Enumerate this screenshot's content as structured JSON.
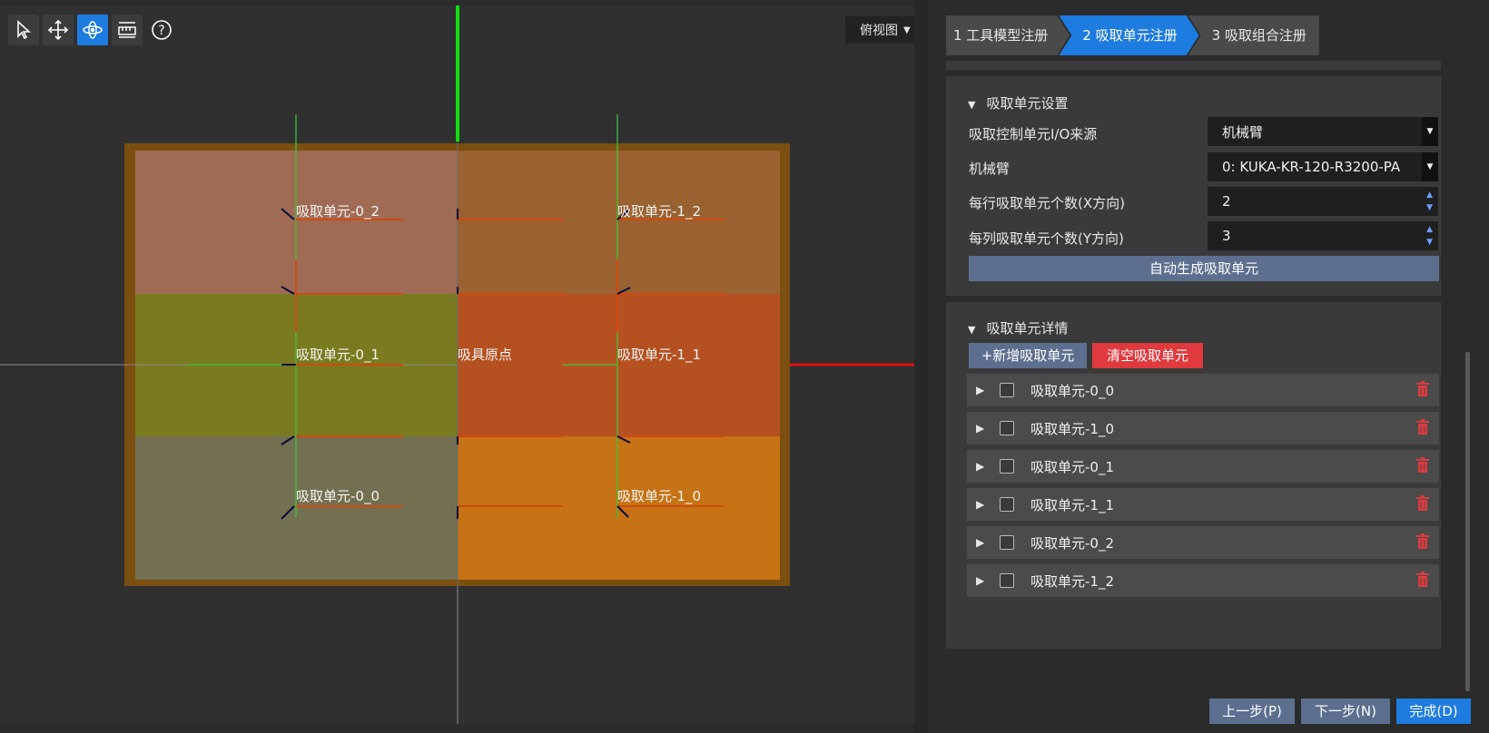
{
  "toolbar": {
    "tools": [
      {
        "name": "select-icon",
        "active": false
      },
      {
        "name": "move-icon",
        "active": false
      },
      {
        "name": "orbit-icon",
        "active": true
      },
      {
        "name": "ruler-icon",
        "active": false
      },
      {
        "name": "help-icon",
        "active": false
      }
    ]
  },
  "view": {
    "selected": "俯视图"
  },
  "scene": {
    "cells": [
      {
        "label": "吸取单元-0_2",
        "color": "#a06b55"
      },
      {
        "label": "",
        "color": "#9a6230"
      },
      {
        "label": "吸取单元-1_2",
        "color": "#9a6230"
      },
      {
        "label": "吸取单元-0_1",
        "color": "#7a7b20"
      },
      {
        "label": "吸具原点",
        "color": "#b55120"
      },
      {
        "label": "吸取单元-1_1",
        "color": "#b55120"
      },
      {
        "label": "吸取单元-0_0",
        "color": "#727050"
      },
      {
        "label": "",
        "color": "#c67315"
      },
      {
        "label": "吸取单元-1_0",
        "color": "#c67315"
      }
    ],
    "frame_color": "#7a4f10",
    "axis_x_color": "#e01010",
    "axis_y_color": "#10e010"
  },
  "steps": [
    {
      "label": "1 工具模型注册",
      "active": false
    },
    {
      "label": "2 吸取单元注册",
      "active": true
    },
    {
      "label": "3 吸取组合注册",
      "active": false
    }
  ],
  "settings": {
    "title": "吸取单元设置",
    "io_source_label": "吸取控制单元I/O来源",
    "io_source_value": "机械臂",
    "robot_label": "机械臂",
    "robot_value": "0: KUKA-KR-120-R3200-PA",
    "x_count_label": "每行吸取单元个数(X方向)",
    "x_count_value": "2",
    "y_count_label": "每列吸取单元个数(Y方向)",
    "y_count_value": "3",
    "auto_generate_label": "自动生成吸取单元"
  },
  "details": {
    "title": "吸取单元详情",
    "add_label": "+新增吸取单元",
    "clear_label": "清空吸取单元",
    "items": [
      "吸取单元-0_0",
      "吸取单元-1_0",
      "吸取单元-0_1",
      "吸取单元-1_1",
      "吸取单元-0_2",
      "吸取单元-1_2"
    ]
  },
  "footer": {
    "prev_label": "上一步(P)",
    "next_label": "下一步(N)",
    "finish_label": "完成(D)"
  },
  "colors": {
    "accent": "#1e7be0",
    "danger": "#e03a3e",
    "secondary_button": "#5d6f8f"
  }
}
